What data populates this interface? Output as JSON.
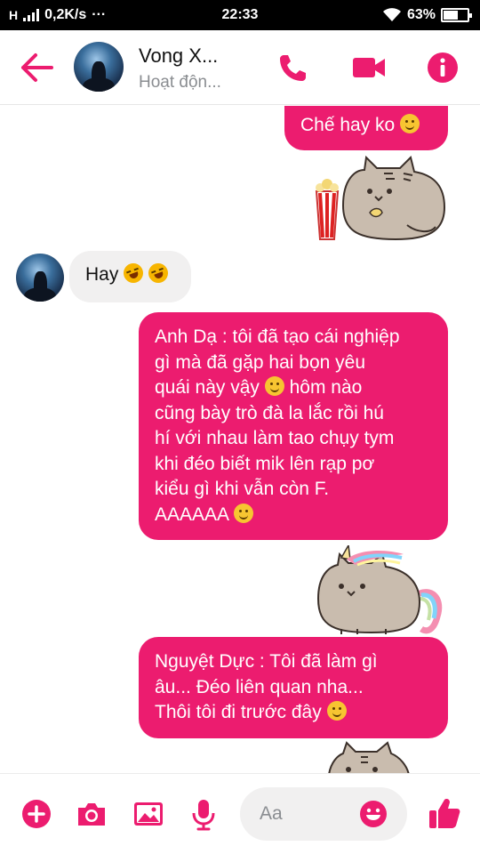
{
  "status_bar": {
    "network": "H",
    "speed": "0,2K/s",
    "more": "···",
    "time": "22:33",
    "battery_text": "63%",
    "battery_level": 0.63
  },
  "header": {
    "contact_name": "Vong X...",
    "contact_status": "Hoạt độn...",
    "icons": [
      "back-arrow-icon",
      "phone-icon",
      "video-camera-icon",
      "info-icon"
    ]
  },
  "messages": [
    {
      "direction": "outgoing",
      "text": "Chế hay ko",
      "emoji_after": "smile"
    },
    {
      "direction": "outgoing",
      "sticker": "pusheen-popcorn-sticker"
    },
    {
      "direction": "incoming",
      "text": "Hay",
      "emoji_after": "laugh-crying x2"
    },
    {
      "direction": "outgoing",
      "lines": [
        "Anh Dạ : tôi đã tạo cái nghiệp",
        "gì mà đã gặp hai bọn yêu",
        "quái này vậy",
        "hôm nào",
        "cũng bày trò đà la lắc rồi hú",
        "hí với nhau làm tao chụy tym",
        "khi đéo biết mik lên rạp pơ",
        "kiểu gì khi vẫn còn F.",
        "AAAAAA"
      ]
    },
    {
      "direction": "outgoing",
      "sticker": "pusheen-unicorn-sticker"
    },
    {
      "direction": "outgoing",
      "lines": [
        "Nguyệt Dực : Tôi đã làm gì",
        "âu...  Đéo liên quan nha...",
        "Thôi tôi đi trước đây"
      ]
    },
    {
      "direction": "outgoing",
      "sticker": "pusheen-partial-sticker"
    }
  ],
  "composer": {
    "placeholder": "Aa",
    "icons": [
      "plus-icon",
      "camera-icon",
      "image-icon",
      "microphone-icon",
      "emoji-icon",
      "thumbs-up-icon"
    ]
  },
  "colors": {
    "accent": "#ec1c6f",
    "incoming_bubble": "#f1f0f0"
  }
}
